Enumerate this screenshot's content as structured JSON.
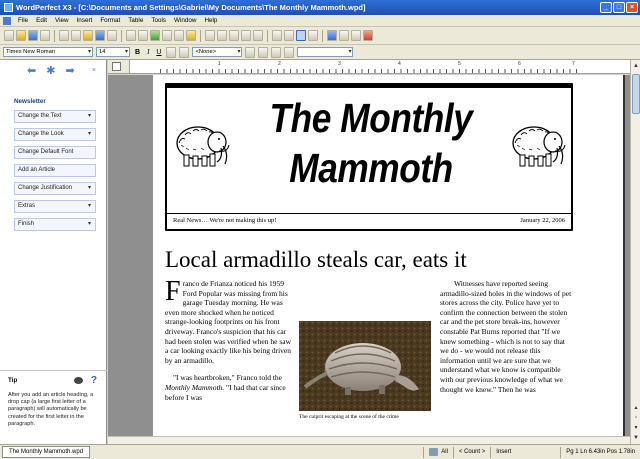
{
  "window": {
    "title": "WordPerfect X3 - [C:\\Documents and Settings\\Gabriel\\My Documents\\The Monthly Mammoth.wpd]"
  },
  "menu": [
    "File",
    "Edit",
    "View",
    "Insert",
    "Format",
    "Table",
    "Tools",
    "Window",
    "Help"
  ],
  "property_bar": {
    "font": "Times New Roman",
    "size": "14",
    "style": "<None>"
  },
  "sidebar": {
    "section": "Newsletter",
    "items": [
      {
        "label": "Change the Text",
        "dropdown": true
      },
      {
        "label": "Change the Look",
        "dropdown": true
      },
      {
        "label": "Change Default Font",
        "dropdown": false
      },
      {
        "label": "Add an Article",
        "dropdown": false
      },
      {
        "label": "Change Justification",
        "dropdown": true
      },
      {
        "label": "Extras",
        "dropdown": true
      },
      {
        "label": "Finish",
        "dropdown": true
      }
    ],
    "tip_heading": "Tip",
    "tip_text": "After you add an article heading, a drop cap (a large first letter of a paragraph) will automatically be created for the first letter in the paragraph."
  },
  "ruler": {
    "numbers": [
      "1",
      "2",
      "3",
      "4",
      "5",
      "6",
      "7"
    ]
  },
  "document": {
    "masthead_line1": "The Monthly",
    "masthead_line2": "Mammoth",
    "tagline": "Real News… We're not making this up!",
    "date": "January 22, 2006",
    "headline": "Local armadillo steals car, eats it",
    "dropcap": "F",
    "col1_p1": "ranco de Frianza noticed his 1959 Ford Popular was missing from his garage Tuesday morning. He was even more shocked when he noticed strange-looking footprints on his front driveway. Franco's suspicion that his car had been stolen was verified when he saw a car looking exactly like his being driven by an armadillo.",
    "col1_p2a": "\"I was heartbroken,\" Franco told the ",
    "col1_p2em": "Monthly Mammoth",
    "col1_p2b": ". \"I had that car since before I was",
    "col3_text": "Witnesses have reported seeing armadillo-sized holes in the windows of pet stores across the city. Police have yet to confirm the connection between the stolen car and the pet store break-ins, however constable Pat Burns reported that \"If we knew something - which is not to say that we do - we would not release this information until we are sure that we understand what we know is compatible with our previous knowledge of what we thought we knew.\" Then he was",
    "caption": "The culprit escaping at the scene of the crime"
  },
  "statusbar": {
    "doc_tab": "The Monthly Mammoth.wpd",
    "all": "All",
    "count": "< Count >",
    "mode": "Insert",
    "position": "Pg 1 Ln 6.43in Pos 1.78in"
  },
  "colors": {
    "titlebar": "#1e4fb0",
    "accent": "#4a7bd1"
  }
}
